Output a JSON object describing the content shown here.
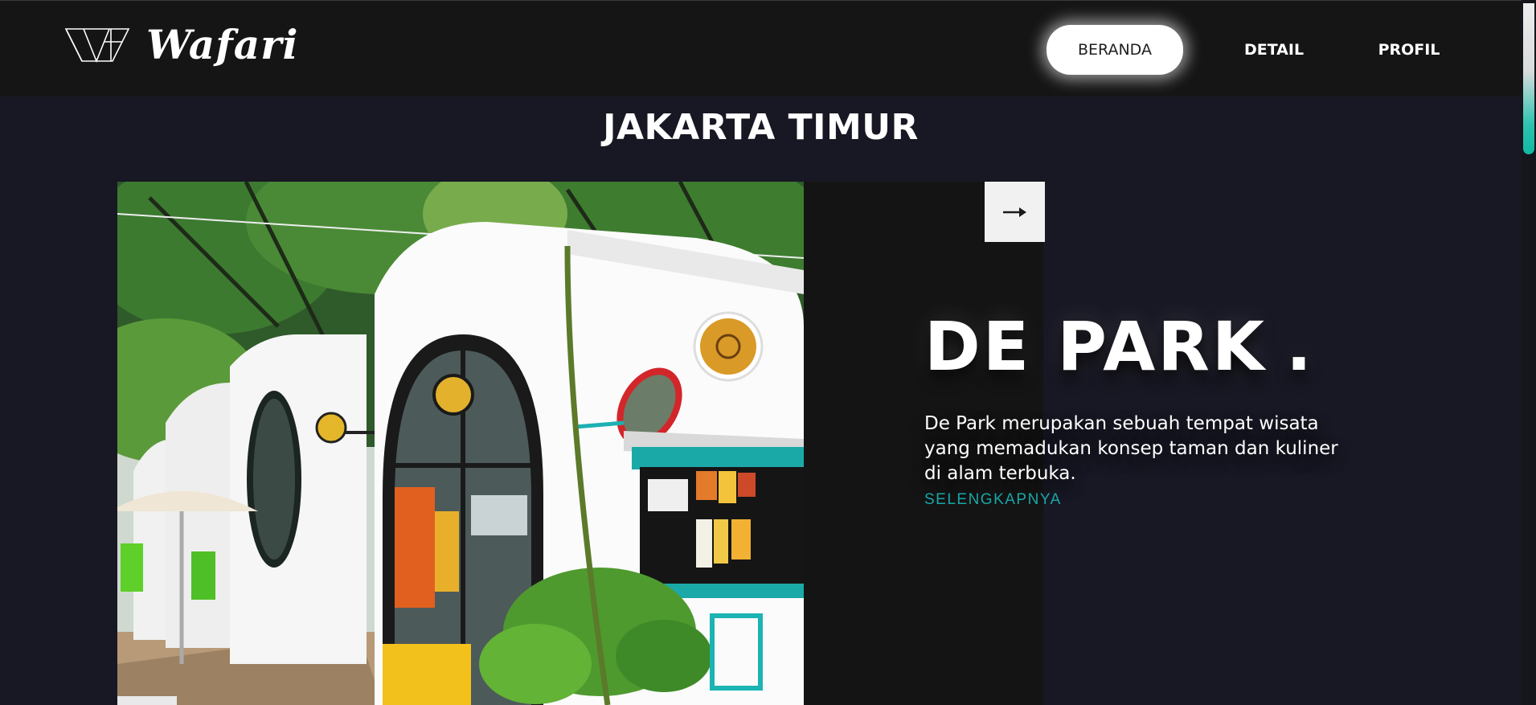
{
  "header": {
    "brand": "Wafari",
    "nav": [
      {
        "label": "BERANDA",
        "active": true
      },
      {
        "label": "DETAIL",
        "active": false
      },
      {
        "label": "PROFIL",
        "active": false
      }
    ]
  },
  "region": {
    "title": "JAKARTA TIMUR"
  },
  "slide": {
    "title": "DE PARK",
    "title_suffix": ".",
    "description": "De Park merupakan sebuah tempat wisata yang memadukan konsep taman dan kuliner di alam terbuka.",
    "link_label": "SELENGKAPNYA",
    "next_icon": "arrow-right-icon"
  },
  "colors": {
    "background": "#181824",
    "header": "#151515",
    "accent": "#19a6a6",
    "panel": "#141414"
  }
}
